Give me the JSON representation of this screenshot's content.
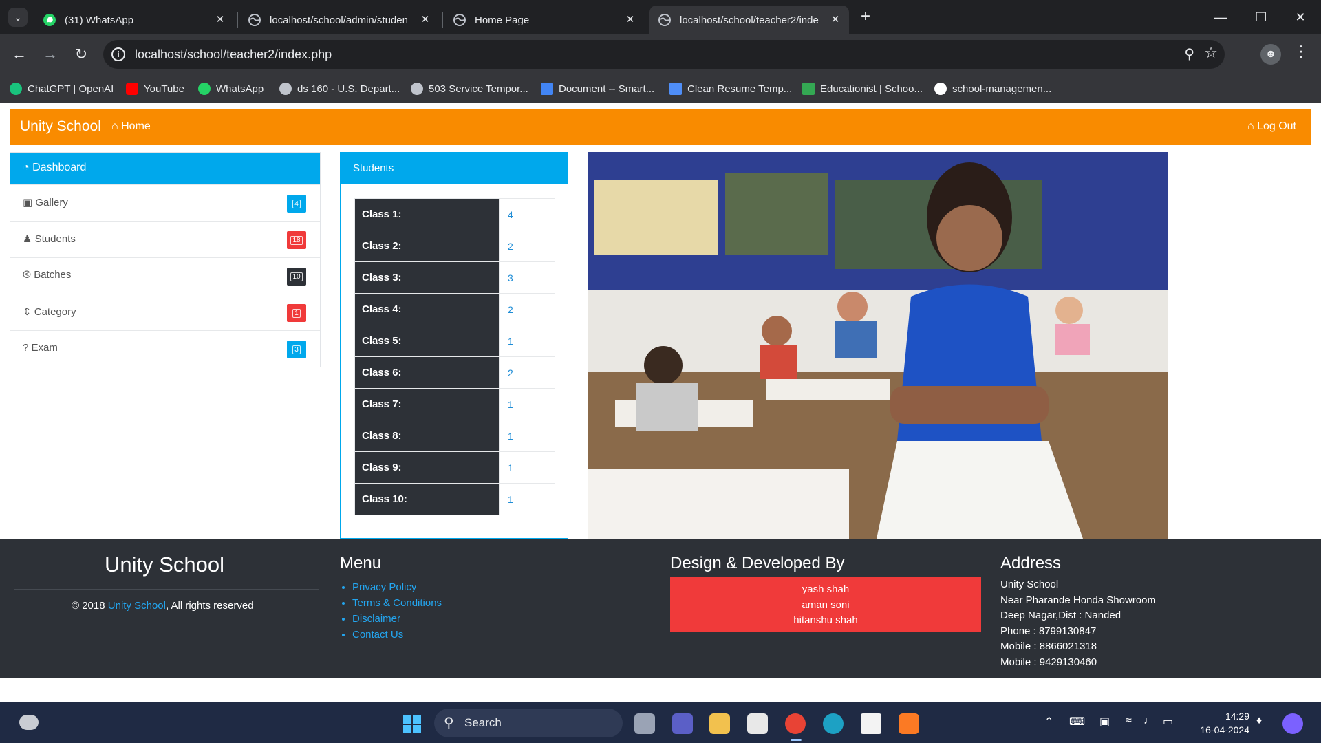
{
  "browser": {
    "tabs": [
      {
        "title": "(31) WhatsApp",
        "icon": "whatsapp-icon"
      },
      {
        "title": "localhost/school/admin/studen",
        "icon": "globe-icon"
      },
      {
        "title": "Home Page",
        "icon": "globe-icon"
      },
      {
        "title": "localhost/school/teacher2/inde",
        "icon": "globe-icon",
        "active": true
      }
    ],
    "url": "localhost/school/teacher2/index.php",
    "bookmarks": [
      {
        "label": "ChatGPT | OpenAI",
        "color": "#19c37d"
      },
      {
        "label": "YouTube",
        "color": "#ff0000"
      },
      {
        "label": "WhatsApp",
        "color": "#25d366"
      },
      {
        "label": "ds 160 - U.S. Depart...",
        "color": "#c0c4cc"
      },
      {
        "label": "503 Service Tempor...",
        "color": "#c0c4cc"
      },
      {
        "label": "Document -- Smart...",
        "color": "#4285f4"
      },
      {
        "label": "Clean Resume Temp...",
        "color": "#4f8ef7"
      },
      {
        "label": "Educationist | Schoo...",
        "color": "#34a853"
      },
      {
        "label": "school-managemen...",
        "color": "#ffffff"
      }
    ]
  },
  "navbar": {
    "brand": "Unity School",
    "home": "Home",
    "logout": "Log Out",
    "color": "#f98b00"
  },
  "sidebar": {
    "title": "Dashboard",
    "items": [
      {
        "label": "Gallery",
        "icon": "camera-icon",
        "count": "4",
        "color": "#00a8ec"
      },
      {
        "label": "Students",
        "icon": "user-icon",
        "count": "18",
        "color": "#f03a3a"
      },
      {
        "label": "Batches",
        "icon": "life-ring-icon",
        "count": "10",
        "color": "#2d3137"
      },
      {
        "label": "Category",
        "icon": "sort-icon",
        "count": "1",
        "color": "#f03a3a"
      },
      {
        "label": "Exam",
        "icon": "question-icon",
        "count": "3",
        "color": "#00a8ec"
      }
    ]
  },
  "students": {
    "title": "Students",
    "rows": [
      {
        "label": "Class 1:",
        "count": "4"
      },
      {
        "label": "Class 2:",
        "count": "2"
      },
      {
        "label": "Class 3:",
        "count": "3"
      },
      {
        "label": "Class 4:",
        "count": "2"
      },
      {
        "label": "Class 5:",
        "count": "1"
      },
      {
        "label": "Class 6:",
        "count": "2"
      },
      {
        "label": "Class 7:",
        "count": "1"
      },
      {
        "label": "Class 8:",
        "count": "1"
      },
      {
        "label": "Class 9:",
        "count": "1"
      },
      {
        "label": "Class 10:",
        "count": "1"
      }
    ]
  },
  "footer": {
    "brand": "Unity School",
    "copyright_prefix": "© 2018",
    "copyright_link": "Unity School",
    "copyright_suffix": ", All rights reserved",
    "menu_title": "Menu",
    "menu": [
      "Privacy Policy",
      "Terms & Conditions",
      "Disclaimer",
      "Contact Us"
    ],
    "dev_title": "Design & Developed By",
    "developers": [
      "yash shah",
      "aman soni",
      "hitanshu shah"
    ],
    "address_title": "Address",
    "address": [
      "Unity School",
      "Near Pharande Honda Showroom",
      "Deep Nagar,Dist : Nanded",
      "Phone : 8799130847",
      "Mobile : 8866021318",
      "Mobile : 9429130460"
    ]
  },
  "taskbar": {
    "search": "Search",
    "time": "14:29",
    "date": "16-04-2024"
  }
}
